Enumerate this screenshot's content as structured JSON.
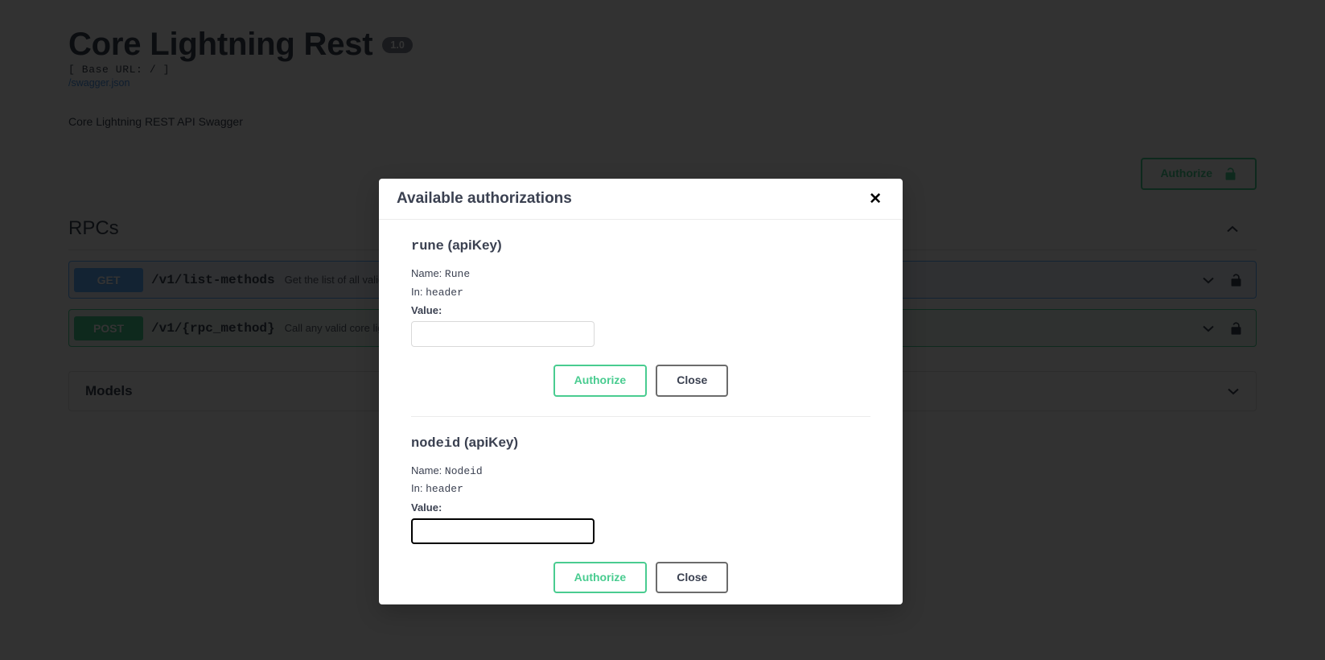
{
  "page": {
    "title": "Core Lightning Rest",
    "version_badge": "1.0",
    "base_url": "[ Base URL: / ]",
    "swagger_link": "/swagger.json",
    "description": "Core Lightning REST API Swagger",
    "authorize_button": "Authorize",
    "authorize_icon": "unlock-icon"
  },
  "sections": {
    "rpcs": {
      "title": "RPCs",
      "toggle_icon": "chevron-up-icon",
      "operations": [
        {
          "verb": "GET",
          "path": "/v1/list-methods",
          "summary": "Get the list of all valid",
          "expand_icon": "chevron-down-icon",
          "lock_icon": "unlock-icon"
        },
        {
          "verb": "POST",
          "path": "/v1/{rpc_method}",
          "summary": "Call any valid core ligh",
          "expand_icon": "chevron-down-icon",
          "lock_icon": "unlock-icon"
        }
      ]
    },
    "models": {
      "title": "Models",
      "toggle_icon": "chevron-down-icon"
    }
  },
  "modal": {
    "title": "Available authorizations",
    "close_icon": "✕",
    "schemes": [
      {
        "name": "rune",
        "type": "(apiKey)",
        "name_label": "Name:",
        "name_value": "Rune",
        "in_label": "In:",
        "in_value": "header",
        "value_label": "Value:",
        "input_value": "",
        "input_placeholder": "",
        "focused": false,
        "authorize_label": "Authorize",
        "close_label": "Close"
      },
      {
        "name": "nodeid",
        "type": "(apiKey)",
        "name_label": "Name:",
        "name_value": "Nodeid",
        "in_label": "In:",
        "in_value": "header",
        "value_label": "Value:",
        "input_value": "",
        "input_placeholder": "",
        "focused": true,
        "authorize_label": "Authorize",
        "close_label": "Close"
      }
    ]
  },
  "colors": {
    "green": "#49cc90",
    "blue": "#61affe",
    "text": "#3b4151",
    "link": "#4990e2",
    "badge": "#7d8492"
  }
}
